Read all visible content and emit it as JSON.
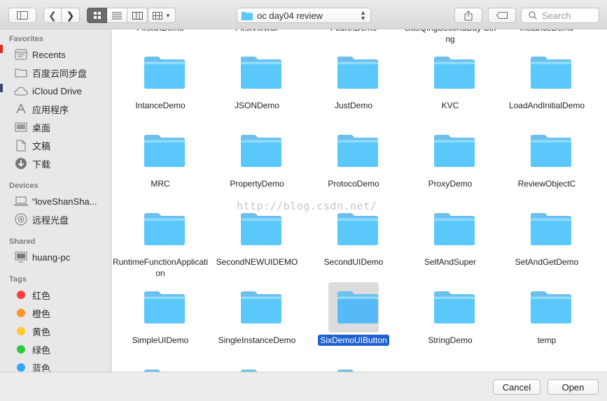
{
  "toolbar": {
    "path_label": "oc day04 review",
    "search_placeholder": "Search"
  },
  "sidebar": {
    "favorites_header": "Favorites",
    "favorites": [
      {
        "label": "Recents",
        "icon": "recents-icon"
      },
      {
        "label": "百度云同步盘",
        "icon": "folder-icon"
      },
      {
        "label": "iCloud Drive",
        "icon": "cloud-icon"
      },
      {
        "label": "应用程序",
        "icon": "applications-icon"
      },
      {
        "label": "桌面",
        "icon": "desktop-icon"
      },
      {
        "label": "文稿",
        "icon": "documents-icon"
      },
      {
        "label": "下载",
        "icon": "downloads-icon"
      }
    ],
    "devices_header": "Devices",
    "devices": [
      {
        "label": "“loveShanSha...",
        "icon": "laptop-icon"
      },
      {
        "label": "远程光盘",
        "icon": "disc-icon"
      }
    ],
    "shared_header": "Shared",
    "shared": [
      {
        "label": "huang-pc",
        "icon": "monitor-icon"
      }
    ],
    "tags_header": "Tags",
    "tags": [
      {
        "label": "红色",
        "color": "#fc3d39"
      },
      {
        "label": "橙色",
        "color": "#fd9426"
      },
      {
        "label": "黄色",
        "color": "#fecb2f"
      },
      {
        "label": "绿色",
        "color": "#2ecc3b"
      },
      {
        "label": "蓝色",
        "color": "#2fa8f7"
      }
    ]
  },
  "files": {
    "top_partial": [
      "FirstUIDemo",
      "FirstViewCr",
      "FourthDemo",
      "GaoQingSecondDay String",
      "InstanceDemo"
    ],
    "rows": [
      [
        "IntanceDemo",
        "JSONDemo",
        "JustDemo",
        "KVC",
        "LoadAndInitialDemo"
      ],
      [
        "MRC",
        "PropertyDemo",
        "ProtocoDemo",
        "ProxyDemo",
        "ReviewObjectC"
      ],
      [
        "RuntimeFunctionApplication",
        "SecondNEWUIDEMO",
        "SecondUIDemo",
        "SelfAndSuper",
        "SetAndGetDemo"
      ],
      [
        "SimpleUIDemo",
        "SingleInstanceDemo",
        "SixDemoUIButton",
        "StringDemo",
        "temp"
      ]
    ],
    "selected": "SixDemoUIButton"
  },
  "watermark": "http://blog.csdn.net/",
  "buttons": {
    "cancel": "Cancel",
    "open": "Open"
  },
  "colors": {
    "folder": "#5ac8fa",
    "selection": "#1e62d0"
  }
}
